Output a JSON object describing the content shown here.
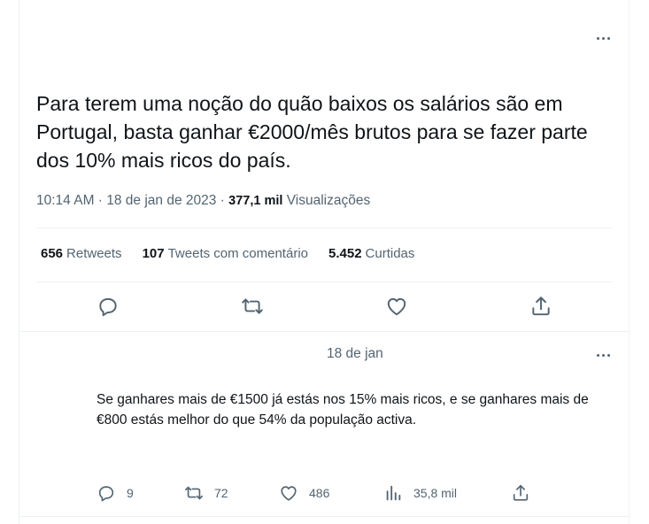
{
  "tweet": {
    "text": "Para terem uma noção do quão baixos os salários são em Portugal, basta ganhar €2000/mês brutos para se fazer parte dos 10% mais ricos do país.",
    "time": "10:14 AM · 18 de jan de 2023 · ",
    "views_count": "377,1 mil",
    "views_label": "Visualizações",
    "stats": {
      "retweets_count": "656",
      "retweets_label": "Retweets",
      "quotes_count": "107",
      "quotes_label": "Tweets com comentário",
      "likes_count": "5.452",
      "likes_label": "Curtidas"
    }
  },
  "reply": {
    "date": "18 de jan",
    "text": "Se ganhares mais de €1500 já estás nos 15% mais ricos, e se ganhares mais de €800 estás melhor do que 54% da população activa.",
    "replies": "9",
    "retweets": "72",
    "likes": "486",
    "views": "35,8 mil"
  },
  "colors": {
    "text": "#0f1419",
    "secondary": "#536471",
    "divider": "#eff3f4"
  }
}
